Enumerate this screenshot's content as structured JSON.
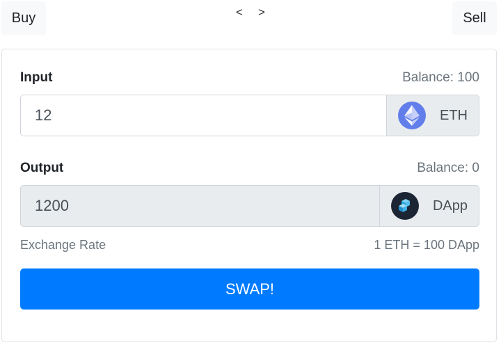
{
  "tabs": {
    "buy_label": "Buy",
    "sell_label": "Sell"
  },
  "nav": {
    "prev": "<",
    "next": ">"
  },
  "input_section": {
    "label": "Input",
    "balance": "Balance: 100",
    "value": "12",
    "token": "ETH",
    "token_icon": "ethereum-icon"
  },
  "output_section": {
    "label": "Output",
    "balance": "Balance: 0",
    "value": "1200",
    "token": "DApp",
    "token_icon": "dapp-token-icon"
  },
  "exchange": {
    "label": "Exchange Rate",
    "rate": "1 ETH = 100 DApp"
  },
  "swap_button": {
    "label": "SWAP!"
  },
  "colors": {
    "primary": "#007bff",
    "eth": "#627eea",
    "dapp": "#1b2533",
    "muted": "#6c757d"
  }
}
